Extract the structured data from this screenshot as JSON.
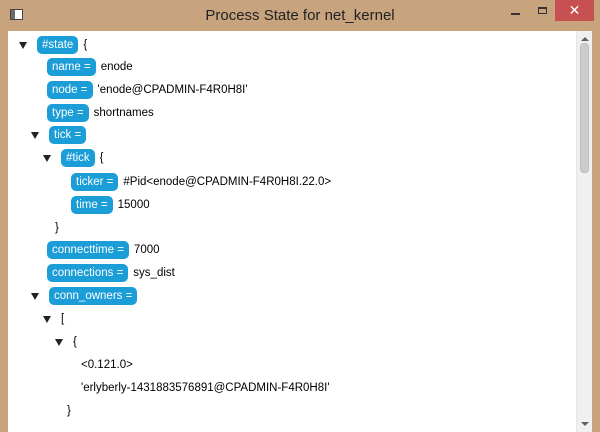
{
  "window": {
    "title": "Process State for net_kernel"
  },
  "tree": {
    "state_key": "#state",
    "state_open": "{",
    "name_key": "name =",
    "name_val": "enode",
    "node_key": "node =",
    "node_val": "'enode@CPADMIN-F4R0H8I'",
    "type_key": "type =",
    "type_val": "shortnames",
    "tick_key": "tick =",
    "tick_record_key": "#tick",
    "tick_record_open": "{",
    "ticker_key": "ticker =",
    "ticker_val": "#Pid<enode@CPADMIN-F4R0H8I.22.0>",
    "time_key": "time =",
    "time_val": "15000",
    "tick_record_close": "}",
    "connecttime_key": "connecttime =",
    "connecttime_val": "7000",
    "connections_key": "connections =",
    "connections_val": "sys_dist",
    "conn_owners_key": "conn_owners =",
    "list_open": "[",
    "tuple_open": "{",
    "pid_val": "<0.121.0>",
    "atom_val": "'erlyberly-1431883576891@CPADMIN-F4R0H8I'",
    "tuple_close": "}"
  }
}
